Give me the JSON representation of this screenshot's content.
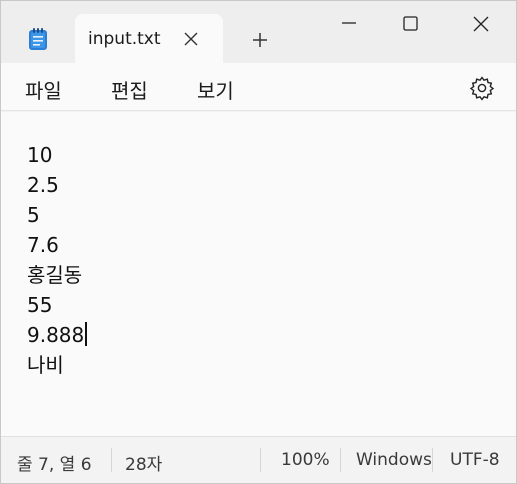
{
  "tab": {
    "title": "input.txt"
  },
  "menu": {
    "file": "파일",
    "edit": "편집",
    "view": "보기"
  },
  "editor": {
    "lines": [
      "10",
      "2.5",
      "5",
      "7.6",
      "홍길동",
      "55",
      "9.888",
      "나비"
    ]
  },
  "status": {
    "position": "줄 7, 열 6",
    "chars": "28자",
    "zoom": "100%",
    "line_ending": "Windows (CRLF)",
    "encoding": "UTF-8"
  },
  "icons": {
    "app": "notepad-icon",
    "close_tab": "close-icon",
    "new_tab": "plus-icon",
    "minimize": "minimize-icon",
    "maximize": "maximize-icon",
    "close_window": "close-icon",
    "settings": "gear-icon"
  },
  "colors": {
    "accent": "#0067c0",
    "window_bg": "#f3f3f3",
    "editor_bg": "#fafafa"
  }
}
